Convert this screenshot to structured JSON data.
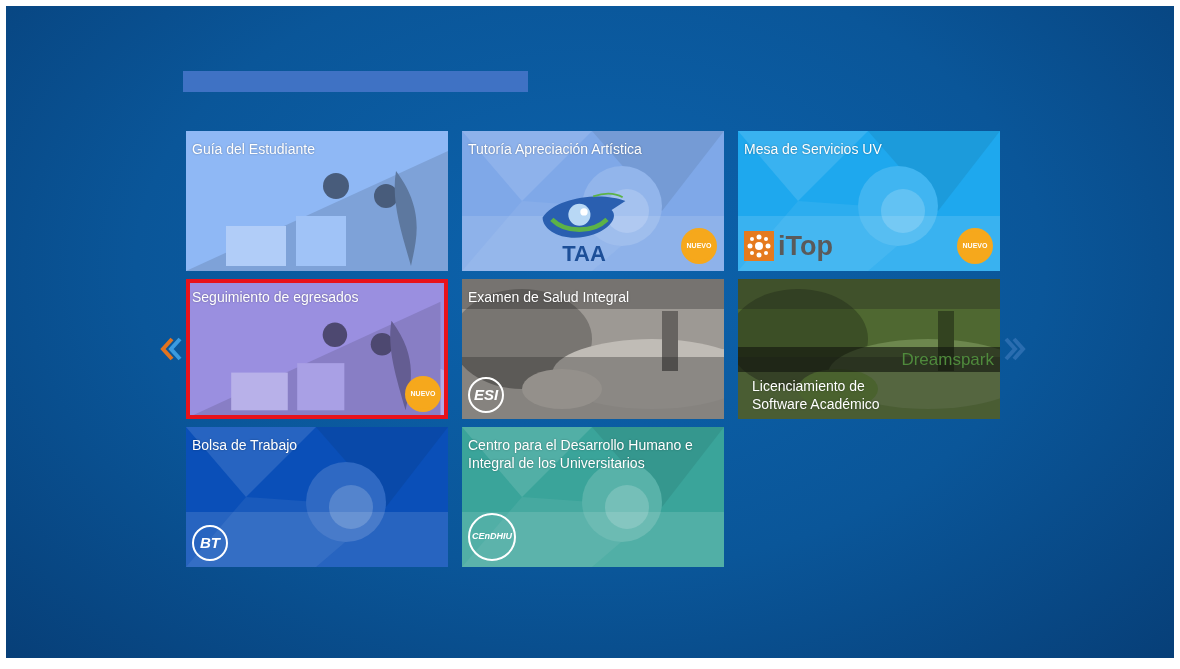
{
  "tiles": [
    {
      "title": "Guía del Estudiante",
      "selected": false,
      "kind": "illustration",
      "color": "#8fb8f5"
    },
    {
      "title": "Tutoría Apreciación Artística",
      "selected": false,
      "kind": "pattern",
      "color": "#7fa8e8",
      "logo": {
        "kind": "eye",
        "text": "TAA"
      },
      "badge": "NUEVO"
    },
    {
      "title": "Mesa de Servicios UV",
      "selected": false,
      "kind": "pattern",
      "color": "#1ea8ee",
      "logo": {
        "kind": "itop",
        "text": "iTop"
      },
      "badge": "NUEVO"
    },
    {
      "title": "Seguimiento de egresados",
      "selected": true,
      "kind": "illustration",
      "color": "#9a8fe0",
      "badge": "NUEVO"
    },
    {
      "title": "Examen de Salud Integral",
      "selected": false,
      "color": "#b9b4ae",
      "logo": {
        "kind": "circle",
        "text": "ESI"
      }
    },
    {
      "title": "Licenciamiento de Software Académico",
      "selected": false,
      "color": "#5d7a3a",
      "logo": {
        "kind": "band",
        "text": "Dreamspark"
      }
    },
    {
      "title": "Bolsa de Trabajo",
      "selected": false,
      "kind": "pattern",
      "color": "#0a4fb8",
      "logo": {
        "kind": "circle",
        "text": "BT"
      }
    },
    {
      "title": "Centro para el Desarrollo Humano e Integral de los Universitarios",
      "selected": false,
      "kind": "pattern",
      "color": "#3aa49a",
      "logo": {
        "kind": "circle",
        "text": "CEnDHIU"
      }
    }
  ]
}
